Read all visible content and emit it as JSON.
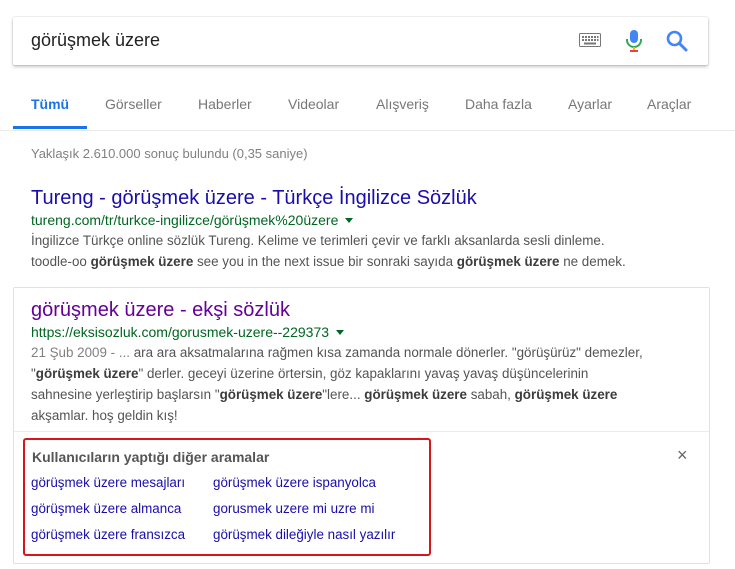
{
  "search": {
    "query": "görüşmek üzere",
    "icons": [
      "keyboard-icon",
      "mic-icon",
      "search-icon"
    ]
  },
  "tabs": [
    {
      "label": "Tümü",
      "active": true
    },
    {
      "label": "Görseller"
    },
    {
      "label": "Haberler"
    },
    {
      "label": "Videolar"
    },
    {
      "label": "Alışveriş"
    },
    {
      "label": "Daha fazla"
    },
    {
      "label": "Ayarlar"
    },
    {
      "label": "Araçlar"
    }
  ],
  "stats": "Yaklaşık 2.610.000 sonuç bulundu (0,35 saniye)",
  "results": [
    {
      "title": "Tureng - görüşmek üzere - Türkçe İngilizce Sözlük",
      "url": "tureng.com/tr/turkce-ingilizce/görüşmek%20üzere",
      "snippet_line1": "İngilizce Türkçe online sözlük Tureng. Kelime ve terimleri çevir ve farklı aksanlarda sesli dinleme.",
      "snippet_line2": [
        "toodle-oo ",
        "görüşmek üzere",
        " see you in the next issue bir sonraki sayıda ",
        "görüşmek üzere",
        " ne demek."
      ]
    },
    {
      "title": "görüşmek üzere - ekşi sözlük",
      "url": "https://eksisozluk.com/gorusmek-uzere--229373",
      "date": "21 Şub 2009 - ...",
      "snippet_line1": " ara ara aksatmalarına rağmen kısa zamanda normale dönerler. \"görüşürüz\" demezler,",
      "snippet_line2": [
        "\"",
        "görüşmek üzere",
        "\" derler. geceyi üzerine örtersin, göz kapaklarını yavaş yavaş düşüncelerinin"
      ],
      "snippet_line3": [
        "sahnesine yerleştirip başlarsın \"",
        "görüşmek üzere",
        "\"lere... ",
        "görüşmek üzere",
        " sabah, ",
        "görüşmek üzere"
      ],
      "snippet_line4": "akşamlar. hoş geldin kış!"
    }
  ],
  "related": {
    "title": "Kullanıcıların yaptığı diğer aramalar",
    "links": [
      "görüşmek üzere mesajları",
      "görüşmek üzere ispanyolca",
      "görüşmek üzere almanca",
      "gorusmek uzere mi uzre mi",
      "görüşmek üzere fransızca",
      "görüşmek dileğiyle nasıl yazılır"
    ],
    "close": "×"
  },
  "colors": {
    "link": "#1a0dab",
    "visited": "#660099",
    "url_green": "#006621",
    "accent_blue": "#1a73e8",
    "highlight_red": "#d6161c"
  }
}
